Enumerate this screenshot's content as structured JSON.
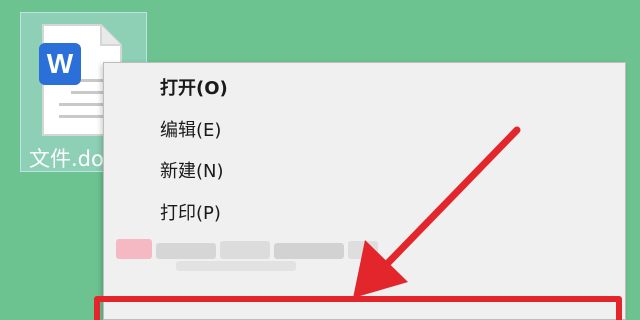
{
  "desktop": {
    "file": {
      "name": "文件.docx",
      "icon": "word-document-icon",
      "app_badge_letter": "W"
    }
  },
  "context_menu": {
    "items": [
      {
        "label": "打开(O)",
        "bold": true
      },
      {
        "label": "编辑(E)",
        "bold": false
      },
      {
        "label": "新建(N)",
        "bold": false
      },
      {
        "label": "打印(P)",
        "bold": false
      }
    ]
  },
  "annotation": {
    "color": "#e2262b",
    "arrow_icon": "red-arrow-icon"
  },
  "colors": {
    "desktop": "#6cc38f",
    "menu_background": "#f0f0f0",
    "word_blue": "#2b70d8"
  }
}
